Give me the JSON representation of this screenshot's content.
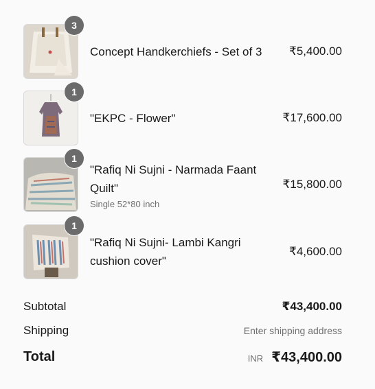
{
  "items": [
    {
      "name": "Concept Handkerchiefs - Set of 3",
      "quantity": "3",
      "price": "₹5,400.00",
      "variant": ""
    },
    {
      "name": "\"EKPC - Flower\"",
      "quantity": "1",
      "price": "₹17,600.00",
      "variant": ""
    },
    {
      "name_line1": "\"Rafiq Ni Sujni - Narmada Faant",
      "name_line2": "Quilt\"",
      "quantity": "1",
      "price": "₹15,800.00",
      "variant": "Single 52*80 inch"
    },
    {
      "name_line1": "\"Rafiq Ni Sujni- Lambi Kangri",
      "name_line2": "cushion cover\"",
      "quantity": "1",
      "price": "₹4,600.00",
      "variant": ""
    }
  ],
  "totals": {
    "subtotal_label": "Subtotal",
    "subtotal_value": "₹43,400.00",
    "shipping_label": "Shipping",
    "shipping_value": "Enter shipping address",
    "total_label": "Total",
    "currency_code": "INR",
    "total_value": "₹43,400.00"
  },
  "icons": {
    "item1": "handkerchief-thumbnail",
    "item2": "dress-thumbnail",
    "item3": "quilt-thumbnail",
    "item4": "cushion-thumbnail"
  }
}
